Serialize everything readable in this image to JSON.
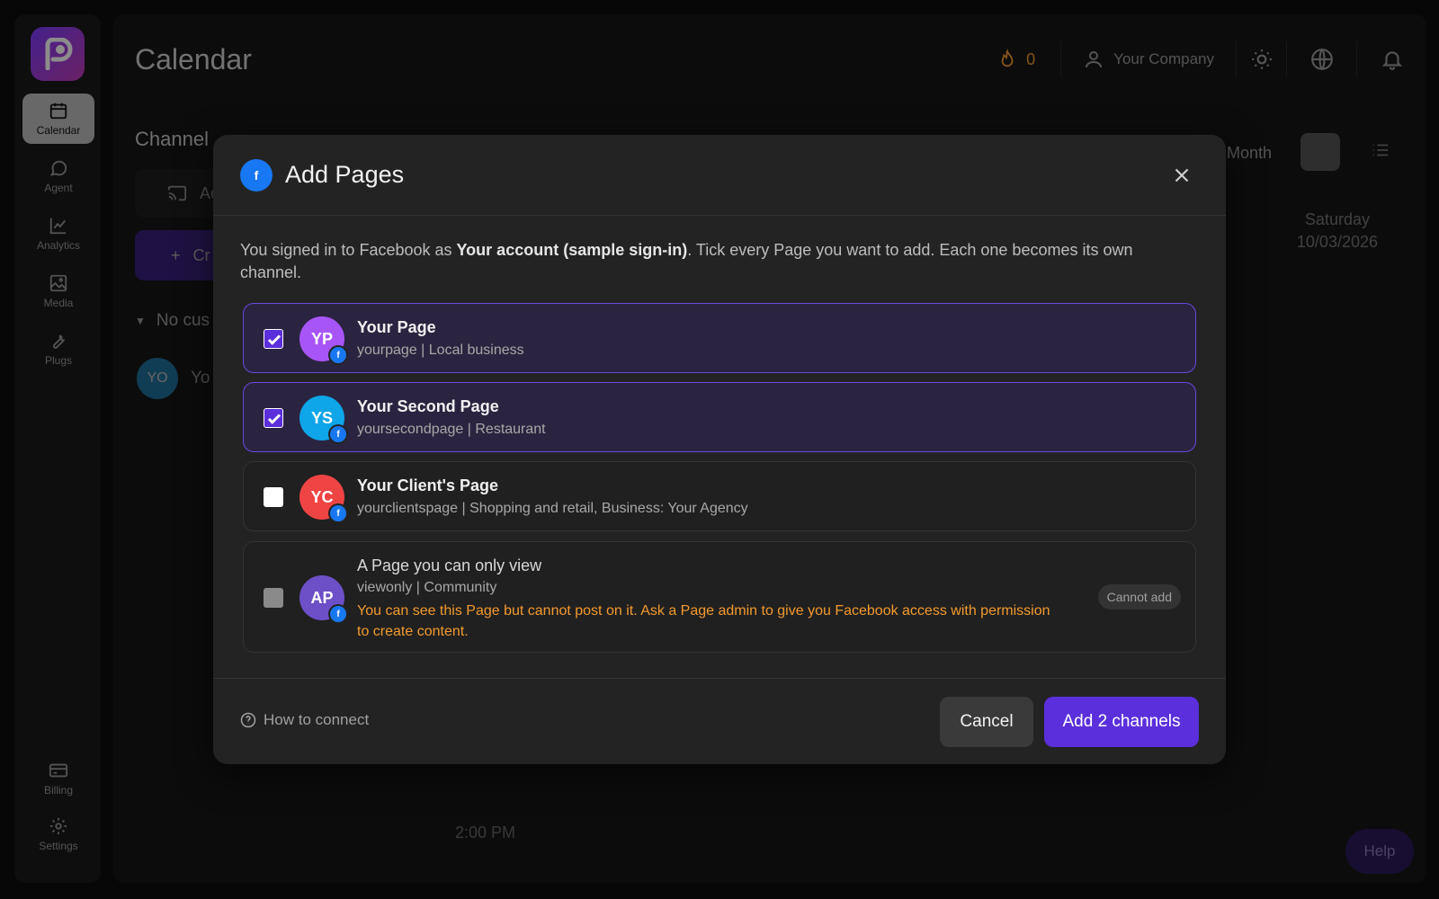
{
  "app": {
    "page_title": "Calendar",
    "streak_count": "0",
    "company": "Your Company",
    "rail": [
      {
        "label": "Calendar"
      },
      {
        "label": "Agent"
      },
      {
        "label": "Analytics"
      },
      {
        "label": "Media"
      },
      {
        "label": "Plugs"
      },
      {
        "label": "Billing"
      },
      {
        "label": "Settings"
      }
    ],
    "channels_title": "Channel",
    "add_label": "Ac",
    "create_label": "Cr",
    "no_customer": "No cus",
    "channel_avatar": "YO",
    "channel_name": "Yo",
    "view_month": "Month",
    "day_name": "Saturday",
    "day_date": "10/03/2026",
    "time_label": "2:00 PM",
    "help_label": "Help"
  },
  "modal": {
    "title": "Add Pages",
    "intro_prefix": "You signed in to Facebook as ",
    "intro_account": "Your account (sample sign-in)",
    "intro_suffix": ". Tick every Page you want to add. Each one becomes its own channel.",
    "pages": [
      {
        "initials": "YP",
        "name": "Your Page",
        "sub": "yourpage | Local business",
        "checked": true,
        "color": "#a855f7"
      },
      {
        "initials": "YS",
        "name": "Your Second Page",
        "sub": "yoursecondpage | Restaurant",
        "checked": true,
        "color": "#0ea5e9"
      },
      {
        "initials": "YC",
        "name": "Your Client's Page",
        "sub": "yourclientspage | Shopping and retail, Business: Your Agency",
        "checked": false,
        "color": "#ef4444"
      },
      {
        "initials": "AP",
        "name": "A Page you can only view",
        "sub": "viewonly | Community",
        "checked": false,
        "disabled": true,
        "color": "#6d4fc7",
        "warning": "You can see this Page but cannot post on it. Ask a Page admin to give you Facebook access with permission to create content.",
        "badge": "Cannot add"
      }
    ],
    "how_to": "How to connect",
    "cancel": "Cancel",
    "add": "Add 2 channels",
    "accent": "#5b2fdc",
    "warn_color": "#f39a2e",
    "fb_color": "#1877f2"
  }
}
